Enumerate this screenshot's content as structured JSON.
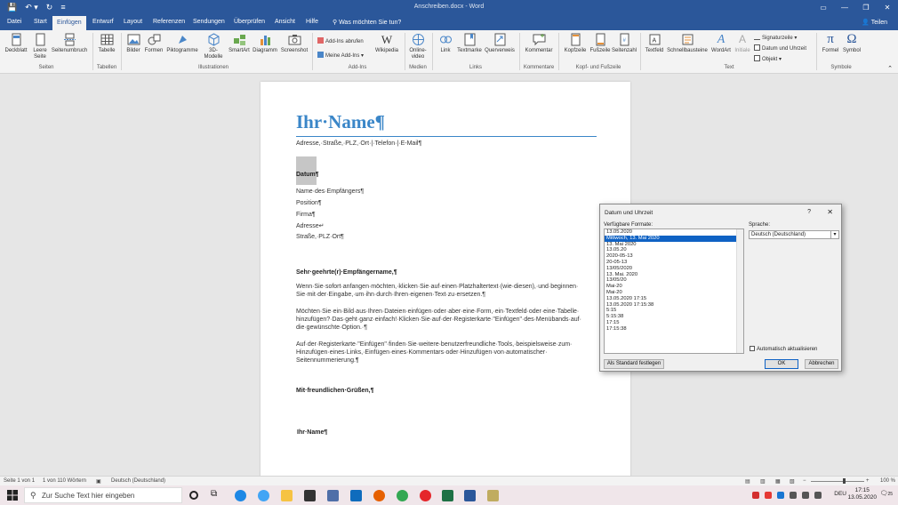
{
  "titlebar": {
    "doc_title": "Anschreiben.docx  -  Word",
    "qat": {
      "save": "💾",
      "undo": "↶ ▾",
      "redo": "↻",
      "customize": "≡"
    },
    "window_controls": {
      "ribbon_display": "▭",
      "minimize": "—",
      "restore": "❐",
      "close": "✕"
    }
  },
  "tabs": [
    {
      "label": "Datei"
    },
    {
      "label": "Start"
    },
    {
      "label": "Einfügen"
    },
    {
      "label": "Entwurf"
    },
    {
      "label": "Layout"
    },
    {
      "label": "Referenzen"
    },
    {
      "label": "Sendungen"
    },
    {
      "label": "Überprüfen"
    },
    {
      "label": "Ansicht"
    },
    {
      "label": "Hilfe"
    },
    {
      "label": "Was möchten Sie tun?"
    }
  ],
  "share_label": "Teilen",
  "ribbon": {
    "seiten": {
      "deckblatt": "Deckblatt",
      "leere_seite": "Leere Seite",
      "seitenumbruch": "Seitenumbruch",
      "group": "Seiten"
    },
    "tabellen": {
      "tabelle": "Tabelle",
      "group": "Tabellen"
    },
    "illustrationen": {
      "bilder": "Bilder",
      "formen": "Formen",
      "piktogramme": "Piktogramme",
      "modelle": "3D-Modelle",
      "smartart": "SmartArt",
      "diagramm": "Diagramm",
      "screenshot": "Screenshot",
      "group": "Illustrationen"
    },
    "addins": {
      "abrufen": "Add-Ins abrufen",
      "meine": "Meine Add-Ins",
      "wikipedia": "Wikipedia",
      "group": "Add-Ins"
    },
    "medien": {
      "onlinevideo": "Online-video",
      "group": "Medien"
    },
    "links": {
      "link": "Link",
      "textmarke": "Textmarke",
      "querverweis": "Querverweis",
      "group": "Links"
    },
    "kommentare": {
      "kommentar": "Kommentar",
      "group": "Kommentare"
    },
    "kopf": {
      "kopfzeile": "Kopfzeile",
      "fusszeile": "Fußzeile",
      "seitenzahl": "Seitenzahl",
      "group": "Kopf- und Fußzeile"
    },
    "text": {
      "textfeld": "Textfeld",
      "schnellbausteine": "Schnellbausteine",
      "wordart": "WordArt",
      "initiale": "Initiale",
      "signatur": "Signaturzeile",
      "datum": "Datum und Uhrzeit",
      "objekt": "Objekt",
      "group": "Text"
    },
    "symbole": {
      "formel": "Formel",
      "symbol": "Symbol",
      "group": "Symbole"
    }
  },
  "document": {
    "name": "Ihr·Name¶",
    "contact": "Adresse,·Straße,·PLZ,·Ort·|·Telefon·|·E-Mail¶",
    "date": "Datum¶",
    "recipient": [
      "Name·des·Empfängers¶",
      "Position¶",
      "Firma¶",
      "Adresse↵",
      "Straße,·PLZ·Ort¶"
    ],
    "salutation": "Sehr·geehrte(r)·Empfängername,¶",
    "para1": [
      "Wenn·Sie·sofort·anfangen·möchten,·klicken·Sie·auf·einen·Platzhaltertext·(wie·diesen),·und·beginnen·",
      "Sie·mit·der·Eingabe,·um·ihn·durch·Ihren·eigenen·Text·zu·ersetzen.¶"
    ],
    "para2": [
      "Möchten·Sie·ein·Bild·aus·Ihren·Dateien·einfügen·oder·aber·eine·Form,·ein·Textfeld·oder·eine·Tabelle·",
      "hinzufügen?·Das·geht·ganz·einfach!·Klicken·Sie·auf·der·Registerkarte·\"Einfügen\"·des·Menübands·auf·",
      "die·gewünschte·Option.·¶"
    ],
    "para3": [
      "Auf·der·Registerkarte·\"Einfügen\"·finden·Sie·weitere·benutzerfreundliche·Tools,·beispielsweise·zum·",
      "Hinzufügen·eines·Links,·Einfügen·eines·Kommentars·oder·Hinzufügen·von·automatischer·",
      "Seitennummerierung.¶"
    ],
    "closing": "Mit·freundlichen·Grüßen,¶",
    "signature": "Ihr·Name¶"
  },
  "dialog": {
    "title": "Datum und Uhrzeit",
    "help": "?",
    "close": "✕",
    "formats_label": "Verfügbare Formate:",
    "formats": [
      "13.05.2020",
      "Mittwoch, 13. Mai 2020",
      "13. Mai 2020",
      "13.05.20",
      "2020-05-13",
      "20-05-13",
      "13/05/2020",
      "13. Mai. 2020",
      "13/05/20",
      "Mai-20",
      "Mai-20",
      "13.05.2020 17:15",
      "13.05.2020 17:15:38",
      "5:15",
      "5:15:38",
      "17:15",
      "17:15:38"
    ],
    "selected_index": 1,
    "language_label": "Sprache:",
    "language_value": "Deutsch (Deutschland)",
    "auto_update_label": "Automatisch aktualisieren",
    "default_button": "Als Standard festlegen",
    "ok_button": "OK",
    "cancel_button": "Abbrechen"
  },
  "status": {
    "page": "Seite 1 von 1",
    "words": "1 von 110 Wörtern",
    "language": "Deutsch (Deutschland)",
    "zoom": "100 %"
  },
  "taskbar": {
    "search_placeholder": "Zur Suche Text hier eingeben",
    "language": "DEU",
    "time": "17:15",
    "date": "13.05.2020",
    "notification_count": "25"
  },
  "colors": {
    "word_blue": "#2b579a",
    "heading_blue": "#3a86c8",
    "selection": "#0f62c4"
  }
}
